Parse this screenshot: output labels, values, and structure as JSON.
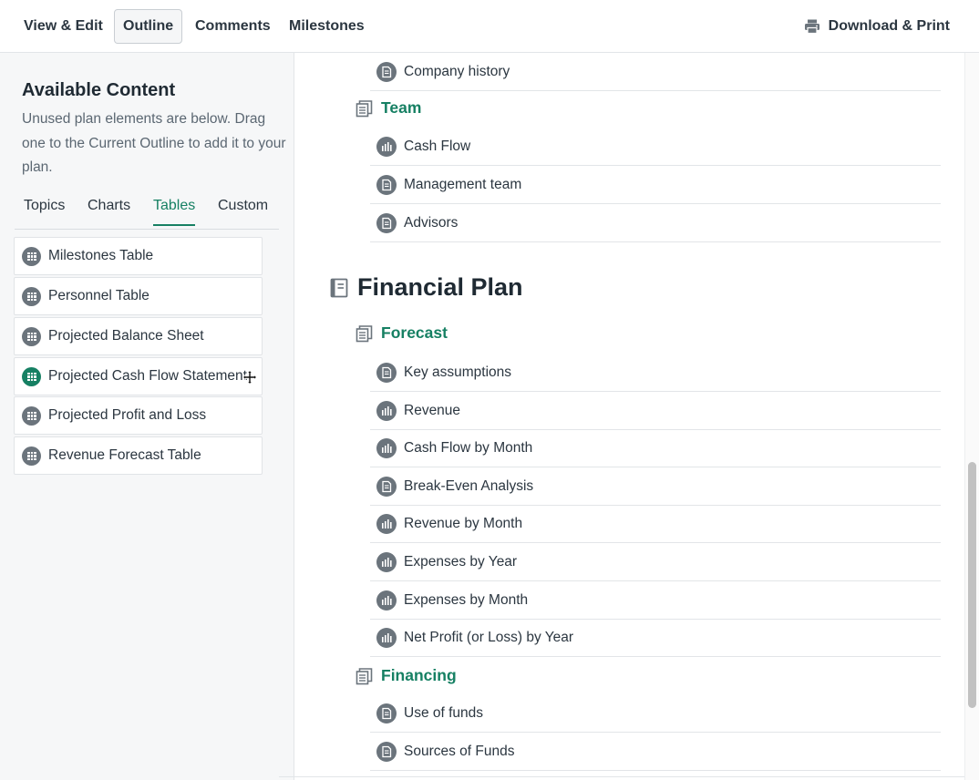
{
  "nav": {
    "tabs": [
      {
        "label": "View & Edit",
        "active": false
      },
      {
        "label": "Outline",
        "active": true
      },
      {
        "label": "Comments",
        "active": false
      },
      {
        "label": "Milestones",
        "active": false
      }
    ],
    "download": {
      "label": "Download & Print",
      "icon": "printer-icon"
    }
  },
  "sidebar": {
    "title": "Available Content",
    "description": "Unused plan elements are below. Drag one to the Current Outline to add it to your plan.",
    "tabs": [
      {
        "label": "Topics",
        "active": false
      },
      {
        "label": "Charts",
        "active": false
      },
      {
        "label": "Tables",
        "active": true
      },
      {
        "label": "Custom",
        "active": false
      }
    ],
    "items": [
      {
        "label": "Milestones Table",
        "icon": "table-grid-icon"
      },
      {
        "label": "Personnel Table",
        "icon": "table-grid-icon"
      },
      {
        "label": "Projected Balance Sheet",
        "icon": "table-grid-icon"
      },
      {
        "label": "Projected Cash Flow Statement",
        "icon": "table-grid-icon",
        "dragging": true
      },
      {
        "label": "Projected Profit and Loss",
        "icon": "table-grid-icon"
      },
      {
        "label": "Revenue Forecast Table",
        "icon": "table-grid-icon"
      }
    ]
  },
  "outline": {
    "company_history": {
      "label": "Company history",
      "icon": "document-icon"
    },
    "team": {
      "title": "Team",
      "items": [
        {
          "label": "Cash Flow",
          "icon": "chart-icon"
        },
        {
          "label": "Management team",
          "icon": "document-icon"
        },
        {
          "label": "Advisors",
          "icon": "document-icon"
        }
      ]
    },
    "chapter": {
      "title": "Financial Plan",
      "icon": "book-icon"
    },
    "forecast": {
      "title": "Forecast",
      "items": [
        {
          "label": "Key assumptions",
          "icon": "document-icon"
        },
        {
          "label": "Revenue",
          "icon": "chart-icon"
        },
        {
          "label": "Cash Flow by Month",
          "icon": "chart-icon"
        },
        {
          "label": "Break-Even Analysis",
          "icon": "document-icon"
        },
        {
          "label": "Revenue by Month",
          "icon": "chart-icon"
        },
        {
          "label": "Expenses by Year",
          "icon": "chart-icon"
        },
        {
          "label": "Expenses by Month",
          "icon": "chart-icon"
        },
        {
          "label": "Net Profit (or Loss) by Year",
          "icon": "chart-icon"
        }
      ]
    },
    "financing": {
      "title": "Financing",
      "items": [
        {
          "label": "Use of funds",
          "icon": "document-icon"
        },
        {
          "label": "Sources of Funds",
          "icon": "document-icon"
        }
      ]
    }
  },
  "colors": {
    "accent": "#168063",
    "icon_gray": "#6b747c",
    "text": "#2b3640"
  }
}
